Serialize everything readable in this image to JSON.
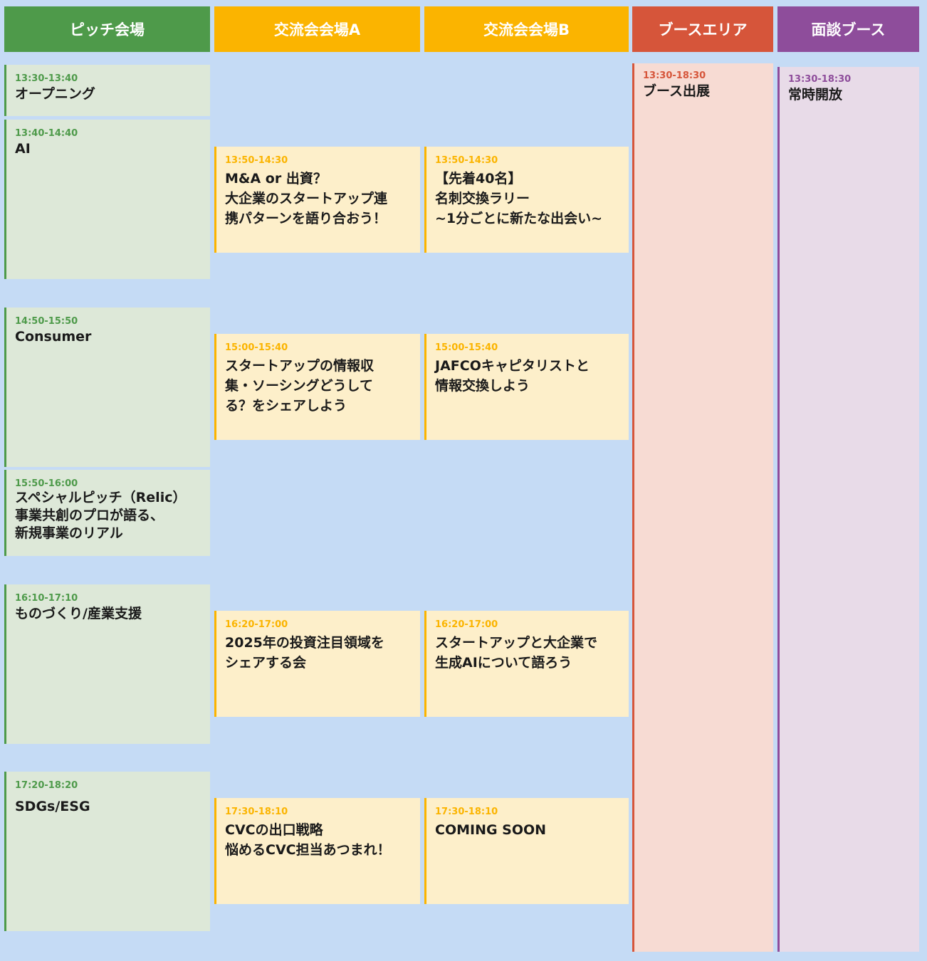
{
  "colors": {
    "background": "#c5dbf5",
    "pitch": "#4e9a4a",
    "exchange": "#fbb400",
    "booth": "#d6553a",
    "interview": "#8e4d9b"
  },
  "headers": {
    "pitch": "ピッチ会場",
    "exchange_a": "交流会会場A",
    "exchange_b": "交流会会場B",
    "booth": "ブースエリア",
    "interview": "面談ブース"
  },
  "pitch": [
    {
      "time": "13:30-13:40",
      "title": "オープニング"
    },
    {
      "time": "13:40-14:40",
      "title": "AI"
    },
    {
      "time": "14:50-15:50",
      "title": "Consumer"
    },
    {
      "time": "15:50-16:00",
      "title": "スペシャルピッチ（Relic）\n事業共創のプロが語る、\n新規事業のリアル"
    },
    {
      "time": "16:10-17:10",
      "title": "ものづくり/産業支援"
    },
    {
      "time": "17:20-18:20",
      "title": "SDGs/ESG"
    }
  ],
  "exchange_a": [
    {
      "time": "13:50-14:30",
      "title": "M&A or 出資？\n大企業のスタートアップ連\n携パターンを語り合おう！"
    },
    {
      "time": "15:00-15:40",
      "title": "スタートアップの情報収\n集・ソーシングどうして\nる？をシェアしよう"
    },
    {
      "time": "16:20-17:00",
      "title": "2025年の投資注目領域を\nシェアする会"
    },
    {
      "time": "17:30-18:10",
      "title": "CVCの出口戦略\n悩めるCVC担当あつまれ！"
    }
  ],
  "exchange_b": [
    {
      "time": "13:50-14:30",
      "title": "【先着40名】\n名刺交換ラリー\n~1分ごとに新たな出会い~"
    },
    {
      "time": "15:00-15:40",
      "title": "JAFCOキャピタリストと\n情報交換しよう"
    },
    {
      "time": "16:20-17:00",
      "title": "スタートアップと大企業で\n生成AIについて語ろう"
    },
    {
      "time": "17:30-18:10",
      "title": "COMING SOON"
    }
  ],
  "booth": {
    "time": "13:30-18:30",
    "title": "ブース出展"
  },
  "interview": {
    "time": "13:30-18:30",
    "title": "常時開放"
  }
}
